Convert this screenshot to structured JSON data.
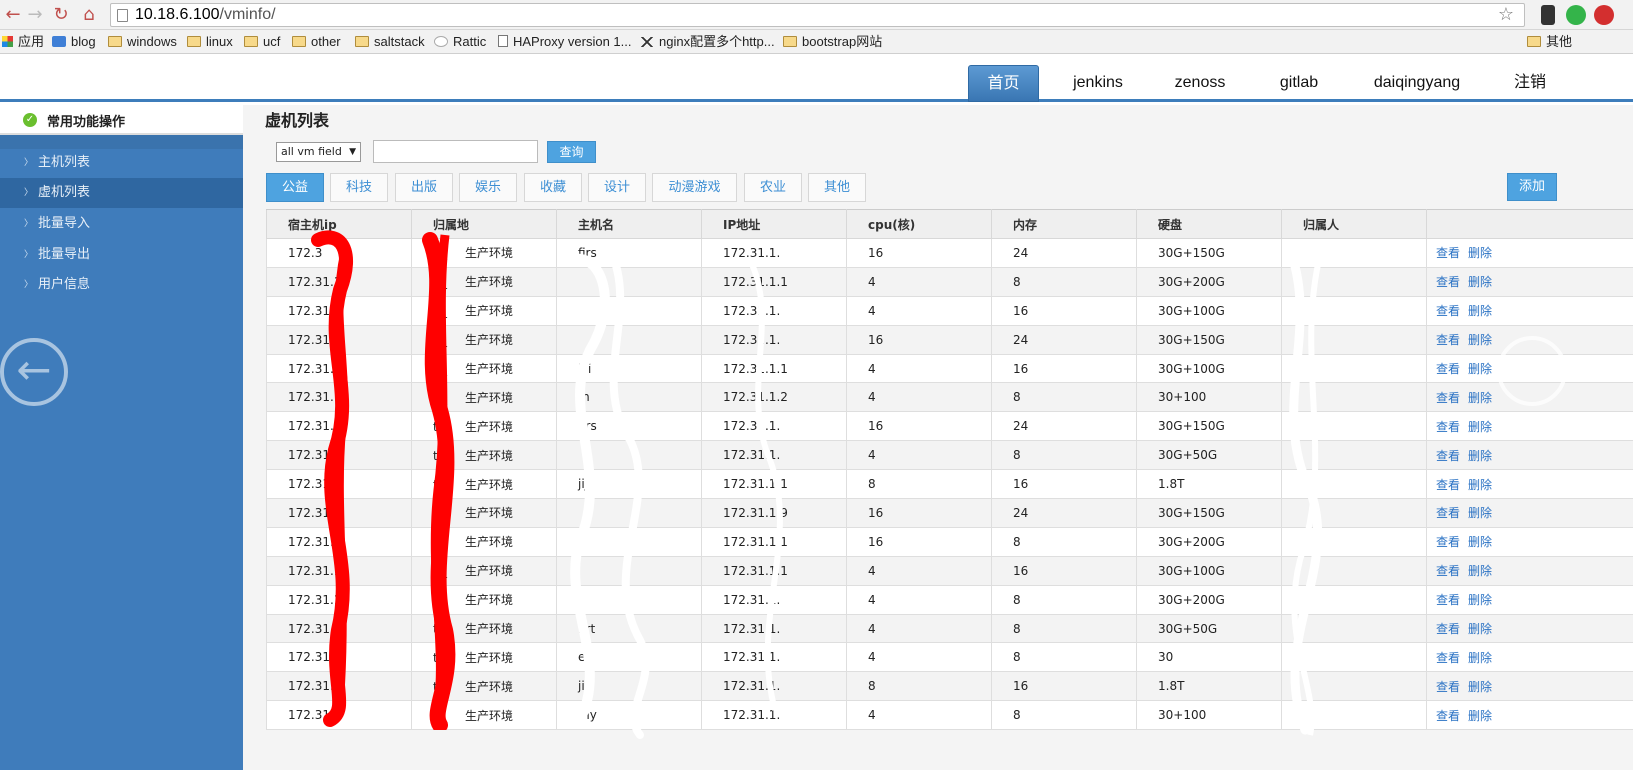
{
  "browser": {
    "url_host": "10.18.6.100",
    "url_path": "/vminfo/",
    "bookmarks": [
      "应用",
      "blog",
      "windows",
      "linux",
      "ucf",
      "other",
      "saltstack",
      "Rattic",
      "HAProxy version 1...",
      "nginx配置多个http...",
      "bootstrap网站",
      "其他"
    ]
  },
  "header": {
    "nav": [
      "首页",
      "jenkins",
      "zenoss",
      "gitlab",
      "daiqingyang",
      "注销"
    ]
  },
  "sidebar": {
    "title": "常用功能操作",
    "items": [
      {
        "label": "主机列表"
      },
      {
        "label": "虚机列表"
      },
      {
        "label": "批量导入"
      },
      {
        "label": "批量导出"
      },
      {
        "label": "用户信息"
      }
    ]
  },
  "main": {
    "title": "虚机列表",
    "field_select": "all vm field",
    "search_button": "查询",
    "add_button": "添加",
    "categories": [
      "公益",
      "科技",
      "出版",
      "娱乐",
      "收藏",
      "设计",
      "动漫游戏",
      "农业",
      "其他"
    ]
  },
  "table": {
    "columns": [
      "宿主机ip",
      "归属地",
      "主机名",
      "IP地址",
      "cpu(核)",
      "内存",
      "硬盘",
      "归属人",
      ""
    ],
    "actions": {
      "view": "查看",
      "delete": "删除"
    },
    "rows": [
      [
        "172.3",
        "tj_",
        "firs",
        "172.31.1.",
        "16",
        "24",
        "30G+150G",
        ""
      ],
      [
        "172.31.1",
        "tj_",
        "",
        "172.31.1.1",
        "4",
        "8",
        "30G+200G",
        ""
      ],
      [
        "172.31.1",
        "tj_",
        "",
        "172.31.1.",
        "4",
        "16",
        "30G+100G",
        ""
      ],
      [
        "172.31.1",
        "tj_",
        "",
        "172.31.1.",
        "16",
        "24",
        "30G+150G",
        ""
      ],
      [
        "172.31.1",
        "tj_",
        "jiji",
        "172.31.1.1",
        "4",
        "16",
        "30G+100G",
        ""
      ],
      [
        "172.31.1",
        "tj_",
        "m",
        "172.31.1.2",
        "4",
        "8",
        "30+100",
        ""
      ],
      [
        "172.31.1",
        "tj_",
        "firs",
        "172.31.1.",
        "16",
        "24",
        "30G+150G",
        ""
      ],
      [
        "172.31.1",
        "tj_",
        "",
        "172.31.1.",
        "4",
        "8",
        "30G+50G",
        ""
      ],
      [
        "172.31.1",
        "tj_",
        "jiji",
        "172.31.1.1",
        "8",
        "16",
        "1.8T",
        ""
      ],
      [
        "172.31.1",
        "tj_",
        "",
        "172.31.1.9",
        "16",
        "24",
        "30G+150G",
        ""
      ],
      [
        "172.31.1",
        "tj_",
        "",
        "172.31.1.1",
        "16",
        "8",
        "30G+200G",
        ""
      ],
      [
        "172.31.1",
        "tj_",
        "",
        "172.31.1.1",
        "4",
        "16",
        "30G+100G",
        ""
      ],
      [
        "172.31.1",
        "tj_",
        "",
        "172.31.1.",
        "4",
        "8",
        "30G+200G",
        ""
      ],
      [
        "172.31.1",
        "tj_",
        "firt",
        "172.31.1.",
        "4",
        "8",
        "30G+50G",
        ""
      ],
      [
        "172.31.1",
        "tj_",
        "ev",
        "172.31.1.",
        "4",
        "8",
        "30",
        ""
      ],
      [
        "172.31.1",
        "tj_",
        "jiji",
        "172.31.1.",
        "8",
        "16",
        "1.8T",
        ""
      ],
      [
        "172.31.1",
        "tj_",
        "my",
        "172.31.1.",
        "4",
        "8",
        "30+100",
        ""
      ]
    ],
    "env_suffix": "生产环境"
  },
  "colors": {
    "accent": "#4ea3e0",
    "sidebar": "#3f7cbb",
    "link": "#2a72c4",
    "redact_red": "#ff0000"
  }
}
